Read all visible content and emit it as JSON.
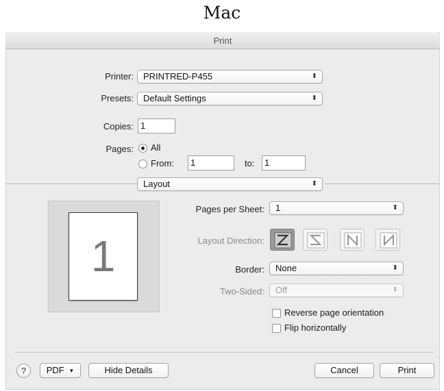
{
  "caption": "Mac",
  "window": {
    "title": "Print"
  },
  "printer": {
    "label": "Printer:",
    "value": "PRINTRED-P455"
  },
  "presets": {
    "label": "Presets:",
    "value": "Default Settings"
  },
  "copies": {
    "label": "Copies:",
    "value": "1"
  },
  "pages": {
    "label": "Pages:",
    "all_label": "All",
    "from_label": "From:",
    "from_value": "1",
    "to_label": "to:",
    "to_value": "1",
    "selected": "All"
  },
  "section_popup": {
    "value": "Layout"
  },
  "preview": {
    "page_number": "1"
  },
  "layout": {
    "pages_per_sheet": {
      "label": "Pages per Sheet:",
      "value": "1"
    },
    "layout_direction": {
      "label": "Layout Direction:",
      "options": [
        "Z-order",
        "S-order",
        "reverse-N-order",
        "N-order"
      ],
      "selected": "Z-order"
    },
    "border": {
      "label": "Border:",
      "value": "None"
    },
    "two_sided": {
      "label": "Two-Sided:",
      "value": "Off",
      "enabled": false
    },
    "reverse_orientation": {
      "label": "Reverse page orientation",
      "checked": false
    },
    "flip_horizontally": {
      "label": "Flip horizontally",
      "checked": false
    }
  },
  "footer": {
    "help_label": "?",
    "pdf_label": "PDF",
    "hide_details_label": "Hide Details",
    "cancel_label": "Cancel",
    "print_label": "Print"
  },
  "icons": {
    "popup_arrows": "updown-chevron-icon",
    "pdf_menu": "triangle-down-icon"
  }
}
